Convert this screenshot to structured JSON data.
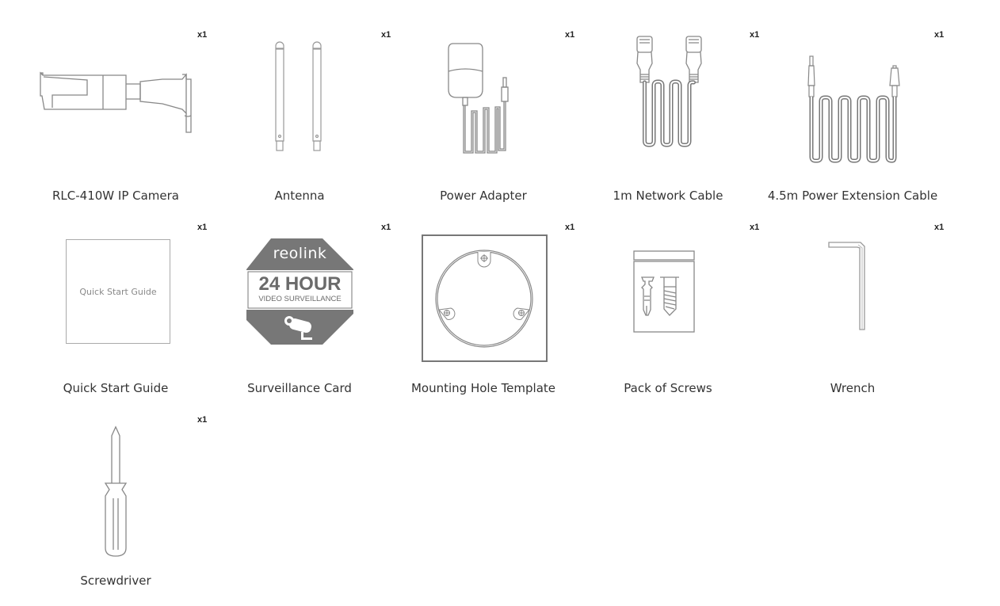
{
  "items": [
    {
      "label": "RLC-410W IP Camera",
      "qty": "x1",
      "icon": "camera-icon"
    },
    {
      "label": "Antenna",
      "qty": "x1",
      "icon": "antenna-icon"
    },
    {
      "label": "Power Adapter",
      "qty": "x1",
      "icon": "power-adapter-icon"
    },
    {
      "label": "1m Network Cable",
      "qty": "x1",
      "icon": "network-cable-icon"
    },
    {
      "label": "4.5m Power Extension Cable",
      "qty": "x1",
      "icon": "extension-cable-icon"
    },
    {
      "label": "Quick Start Guide",
      "qty": "x1",
      "icon": "quick-start-guide-icon",
      "cover_text": "Quick Start Guide"
    },
    {
      "label": "Surveillance Card",
      "qty": "x1",
      "icon": "surveillance-card-icon",
      "brand": "reolink",
      "headline": "24 HOUR",
      "subline": "VIDEO SURVEILLANCE"
    },
    {
      "label": "Mounting Hole Template",
      "qty": "x1",
      "icon": "mounting-template-icon"
    },
    {
      "label": "Pack of Screws",
      "qty": "x1",
      "icon": "screws-pack-icon"
    },
    {
      "label": "Wrench",
      "qty": "x1",
      "icon": "wrench-icon"
    },
    {
      "label": "Screwdriver",
      "qty": "x1",
      "icon": "screwdriver-icon"
    }
  ],
  "colors": {
    "stroke": "#777777",
    "dark": "#6b6b6b",
    "text": "#333333"
  }
}
